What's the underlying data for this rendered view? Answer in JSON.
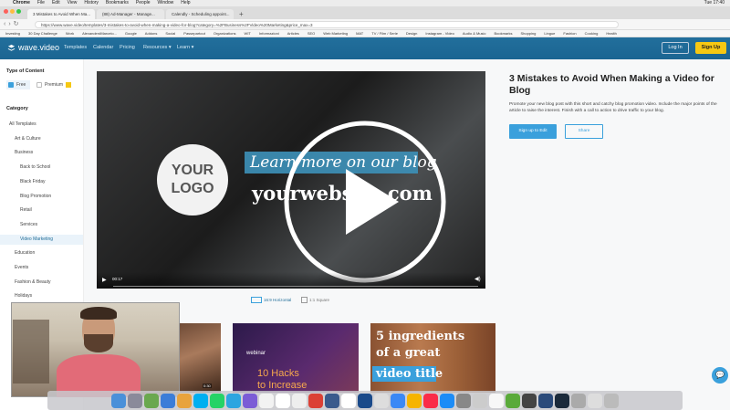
{
  "menubar": {
    "items": [
      "",
      "Chrome",
      "File",
      "Edit",
      "View",
      "History",
      "Bookmarks",
      "People",
      "Window",
      "Help"
    ],
    "clock": "Tue 17:40"
  },
  "tabs": [
    {
      "label": "3 Mistakes to Avoid When Ma..."
    },
    {
      "label": "(88) Ad-Manager - Manage..."
    },
    {
      "label": "Calendly - Scheduling appoint..."
    }
  ],
  "address": {
    "url": "https://www.wave.video/templates/3-mistakes-to-avoid-when-making-a-video-for-blog?category=%2FBusiness%2FVideo%20Marketing&price_max=3"
  },
  "bookmarks": [
    "Investing",
    "30 Day Challenge",
    "Work",
    "AlexanderdMarcelo...",
    "Google",
    "Addons",
    "Social",
    "Passepartout",
    "Organizations",
    "WIT",
    "Informazioni",
    "Articles",
    "SEO",
    "Web Marketing",
    "MAT",
    "TV / Film / Serie",
    "Design",
    "Instagram - Video",
    "Audio & Music",
    "Bookmarks",
    "Shopping",
    "Lingue",
    "Fashion",
    "Cooking",
    "Health"
  ],
  "site": {
    "brand": "wave.video",
    "nav": [
      "Templates",
      "Calendar",
      "Pricing",
      "Resources ▾",
      "Learn ▾"
    ],
    "login": "Log In",
    "signup": "Sign Up"
  },
  "sidebar": {
    "type_heading": "Type of Content",
    "free": "Free",
    "premium": "Premium",
    "category_heading": "Category",
    "items": [
      {
        "label": "All Templates",
        "indent": 0
      },
      {
        "label": "Art & Culture",
        "indent": 1
      },
      {
        "label": "Business",
        "indent": 1
      },
      {
        "label": "Back to School",
        "indent": 2
      },
      {
        "label": "Black Friday",
        "indent": 2
      },
      {
        "label": "Blog Promotion",
        "indent": 2
      },
      {
        "label": "Retail",
        "indent": 2
      },
      {
        "label": "Services",
        "indent": 2
      },
      {
        "label": "Video Marketing",
        "indent": 2,
        "active": true
      },
      {
        "label": "Education",
        "indent": 1
      },
      {
        "label": "Events",
        "indent": 1
      },
      {
        "label": "Fashion & Beauty",
        "indent": 1
      },
      {
        "label": "Holidays",
        "indent": 1
      }
    ]
  },
  "video": {
    "logo_line1": "YOUR",
    "logo_line2": "LOGO",
    "learn": "Learn more on our blog",
    "website": "yourwebsite.com",
    "time": "00:17"
  },
  "formats": {
    "horizontal": "16:9 Horizontal",
    "square": "1:1 Square"
  },
  "detail": {
    "title": "3 Mistakes to Avoid When Making a Video for Blog",
    "description": "Promote your new blog post with this short and catchy blog promotion video. Include the major points of the article to raise the interest. Finish with a call to action to drive traffic to your blog.",
    "edit_button": "Sign up to Edit",
    "share_button": "Share"
  },
  "thumbnails": {
    "t1_time": "0:30",
    "t2_label": "webinar",
    "t2_title1": "10 Hacks",
    "t2_title2": "to Increase",
    "t3_line1": "5 ingredients",
    "t3_line2": "of a great",
    "t3_line3": "video title"
  }
}
